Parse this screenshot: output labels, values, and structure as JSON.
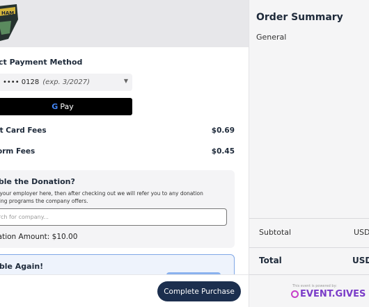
{
  "org": {
    "logo_text": "HAM"
  },
  "payment": {
    "title": "ct Payment Method",
    "card_label": "•••• 0128",
    "card_exp": "(exp. 3/2027)",
    "gpay_g": "G",
    "gpay_label": "Pay"
  },
  "fees": [
    {
      "label": "it Card Fees",
      "value": "$0.69"
    },
    {
      "label": "orm Fees",
      "value": "$0.45"
    }
  ],
  "donation": {
    "title": "uble the Donation?",
    "desc": "ct your employer here, then after checking out we will refer you to any donation ching programs the company offers.",
    "search_placeholder": "arch for company...",
    "amount": "nation Amount: $10.00"
  },
  "double_again": {
    "title": "uble Again!"
  },
  "footer": {
    "complete_label": "Complete Purchase"
  },
  "summary": {
    "title": "Order Summary",
    "category": "General",
    "subtotal_label": "Subtotal",
    "subtotal_value": "USD",
    "total_label": "Total",
    "total_value": "USD"
  },
  "powered": {
    "small": "This event is powered by:",
    "brand": "EVENT.GIVES"
  },
  "colors": {
    "primary": "#1c2f4e",
    "accent": "#7a3cc8",
    "link_blue": "#7fa7e6"
  }
}
